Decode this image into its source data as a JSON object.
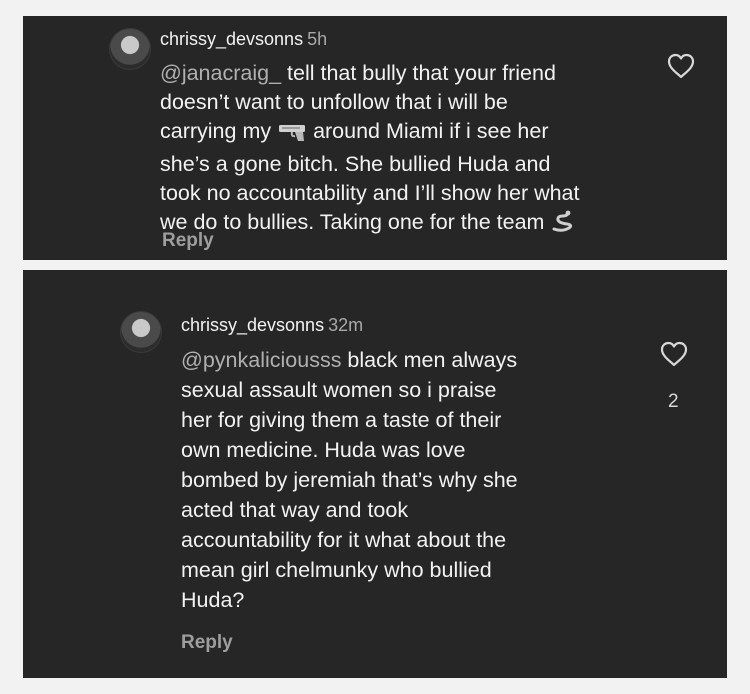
{
  "comments": [
    {
      "username": "chrissy_devsonns",
      "time": "5h",
      "mention": "@janacraig_",
      "lines": [
        " tell that bully that your friend",
        "doesn’t want to unfollow that i will be",
        "carrying my",
        " around Miami if i see her",
        "she’s a gone bitch. She bullied Huda and",
        "took no accountability and I’ll show her what",
        "we do to bullies. Taking one for the team"
      ],
      "emoji": [
        "pistol-emoji",
        "snake-emoji"
      ],
      "reply_label": "Reply",
      "like_icon": "heart-icon"
    },
    {
      "username": "chrissy_devsonns",
      "time": "32m",
      "mention": "@pynkaliciousss",
      "lines": [
        " black men always",
        "sexual assault women so i praise",
        "her for giving them a taste of their",
        "own medicine. Huda was love",
        "bombed by jeremiah that’s why she",
        "acted that way and took",
        "accountability for it what about the",
        "mean girl chelmunky who bullied",
        "Huda?"
      ],
      "reply_label": "Reply",
      "like_icon": "heart-icon",
      "like_count": "2"
    }
  ],
  "colors": {
    "card_bg": "#262626",
    "page_bg": "#f2f2f2",
    "text": "#f2f2f2",
    "muted": "#a8a8a8"
  }
}
